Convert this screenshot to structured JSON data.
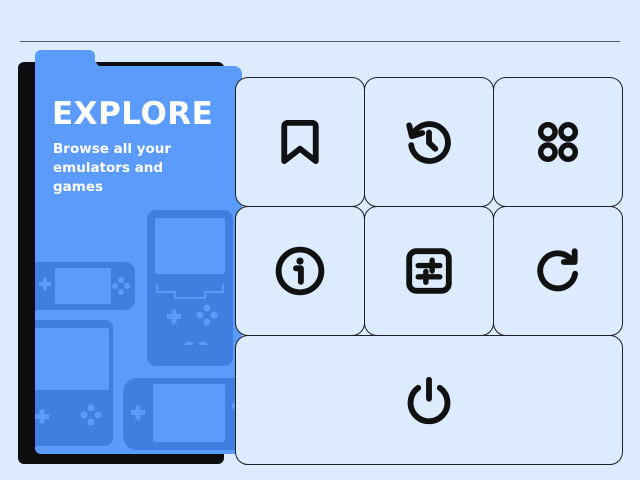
{
  "explore_card": {
    "title": "EXPLORE",
    "description": "Browse all your emulators and games"
  },
  "menu_tiles": [
    {
      "name": "bookmark",
      "icon": "bookmark-icon"
    },
    {
      "name": "history",
      "icon": "history-icon"
    },
    {
      "name": "apps",
      "icon": "apps-grid-icon"
    },
    {
      "name": "info",
      "icon": "info-icon"
    },
    {
      "name": "settings",
      "icon": "sliders-icon"
    },
    {
      "name": "refresh",
      "icon": "refresh-icon"
    },
    {
      "name": "power",
      "icon": "power-icon"
    }
  ],
  "colors": {
    "background": "#dcebfd",
    "card": "#5b9bfb",
    "console_silhouette": "#3f7fe0",
    "tile_border": "#1f2124",
    "icon": "#111111"
  }
}
